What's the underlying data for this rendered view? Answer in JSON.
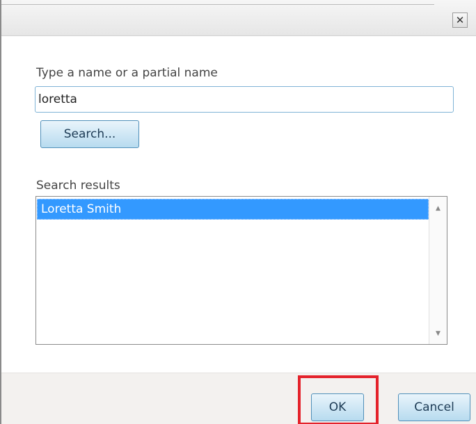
{
  "dialog": {
    "close_symbol": "✕",
    "search_prompt": "Type a name or a partial name",
    "search_value": "loretta",
    "search_button_label": "Search...",
    "results_label": "Search results",
    "results": [
      {
        "name": "Loretta Smith",
        "selected": true
      }
    ],
    "ok_label": "OK",
    "cancel_label": "Cancel"
  },
  "icons": {
    "close": "close-icon",
    "scroll_up": "scroll-up-arrow-icon",
    "scroll_down": "scroll-down-arrow-icon"
  },
  "colors": {
    "selection": "#3399ff",
    "button_border": "#4f8fb9",
    "highlight": "#e4222b"
  }
}
